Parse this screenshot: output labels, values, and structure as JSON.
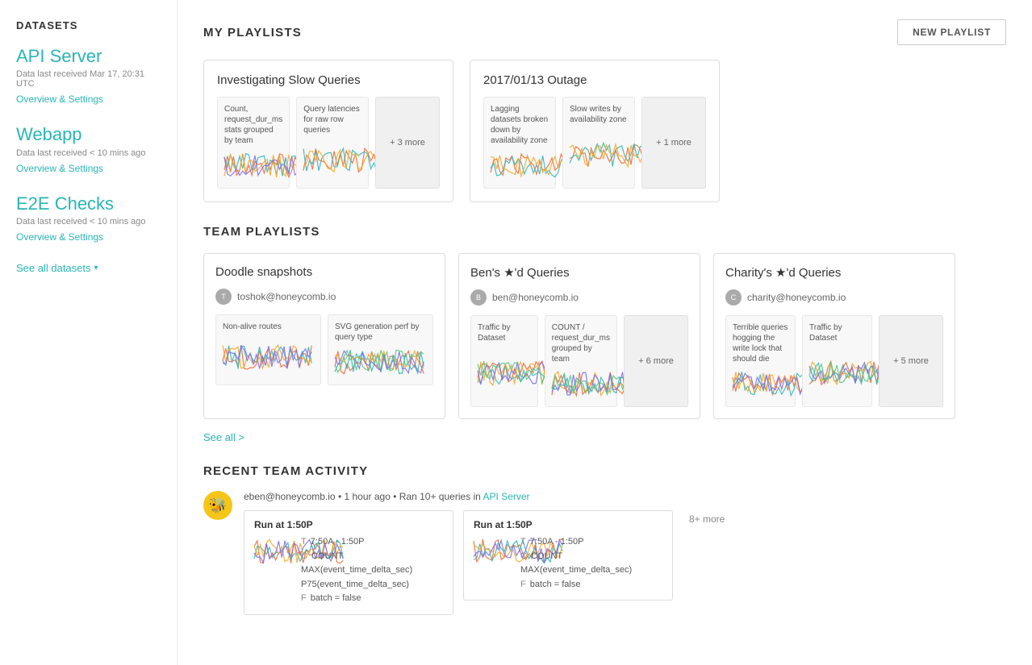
{
  "sidebar": {
    "title": "DATASETS",
    "datasets": [
      {
        "name": "API Server",
        "meta": "Data last received Mar 17, 20:31 UTC",
        "link": "Overview & Settings"
      },
      {
        "name": "Webapp",
        "meta": "Data last received < 10 mins ago",
        "link": "Overview & Settings"
      },
      {
        "name": "E2E Checks",
        "meta": "Data last received < 10 mins ago",
        "link": "Overview & Settings"
      }
    ],
    "see_all": "See all datasets"
  },
  "header": {
    "new_playlist_label": "NEW PLAYLIST"
  },
  "my_playlists": {
    "title": "MY PLAYLISTS",
    "playlists": [
      {
        "id": "slow-queries",
        "title": "Investigating Slow Queries",
        "charts": [
          {
            "label": "Count, request_dur_ms stats grouped by team"
          },
          {
            "label": "Query latencies for raw row queries"
          }
        ],
        "more": "+ 3 more"
      },
      {
        "id": "outage",
        "title": "2017/01/13 Outage",
        "charts": [
          {
            "label": "Lagging datasets broken down by availability zone"
          },
          {
            "label": "Slow writes by availability zone"
          }
        ],
        "more": "+ 1 more"
      }
    ]
  },
  "team_playlists": {
    "title": "TEAM PLAYLISTS",
    "see_all": "See all >",
    "playlists": [
      {
        "id": "doodle",
        "title": "Doodle snapshots",
        "owner": "toshok@honeycomb.io",
        "charts": [
          {
            "label": "Non-alive routes"
          },
          {
            "label": "SVG generation perf by query type"
          }
        ]
      },
      {
        "id": "ben-starred",
        "title": "Ben's ★'d Queries",
        "owner": "ben@honeycomb.io",
        "charts": [
          {
            "label": "Traffic by Dataset"
          },
          {
            "label": "COUNT / request_dur_ms grouped by team"
          }
        ],
        "more": "+ 6 more"
      },
      {
        "id": "charity-starred",
        "title": "Charity's ★'d Queries",
        "owner": "charity@honeycomb.io",
        "charts": [
          {
            "label": "Terrible queries hogging the write lock that should die"
          },
          {
            "label": "Traffic by Dataset"
          }
        ],
        "more": "+ 5 more"
      }
    ]
  },
  "recent_activity": {
    "title": "RECENT TEAM ACTIVITY",
    "entry": {
      "user": "eben@honeycomb.io",
      "time": "1 hour ago",
      "action": "Ran 10+ queries in",
      "dataset": "API Server",
      "cards": [
        {
          "title": "Run at 1:50P",
          "rows": [
            {
              "key": "T",
              "value": "7:50A - 1:50P"
            },
            {
              "key": "C",
              "value": "COUNT"
            },
            {
              "key": "",
              "value": "MAX(event_time_delta_sec)"
            },
            {
              "key": "",
              "value": "P75(event_time_delta_sec)"
            },
            {
              "key": "F",
              "value": "batch = false"
            }
          ]
        },
        {
          "title": "Run at 1:50P",
          "rows": [
            {
              "key": "T",
              "value": "7:50A - 1:50P"
            },
            {
              "key": "C",
              "value": "COUNT"
            },
            {
              "key": "",
              "value": "MAX(event_time_delta_sec)"
            },
            {
              "key": "F",
              "value": "batch = false"
            }
          ]
        }
      ],
      "more": "8+ more"
    }
  }
}
